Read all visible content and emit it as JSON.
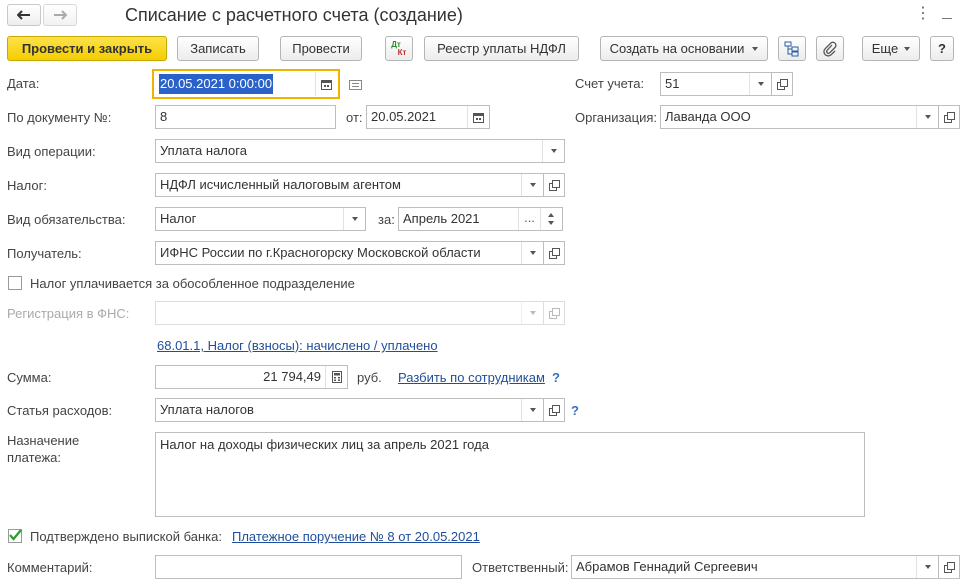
{
  "window": {
    "title": "Списание с расчетного счета (создание)"
  },
  "toolbar": {
    "post_close": "Провести и закрыть",
    "write": "Записать",
    "post": "Провести",
    "dtkt_top": "Дт",
    "dtkt_bottom": "Кт",
    "registry": "Реестр уплаты НДФЛ",
    "create_based": "Создать на основании",
    "more": "Еще",
    "help": "?"
  },
  "form": {
    "date_label": "Дата:",
    "date_value": "20.05.2021  0:00:00",
    "account_label": "Счет учета:",
    "account_value": "51",
    "docnum_label": "По документу №:",
    "docnum_value": "8",
    "from_label": "от:",
    "from_value": "20.05.2021",
    "org_label": "Организация:",
    "org_value": "Лаванда ООО",
    "optype_label": "Вид операции:",
    "optype_value": "Уплата налога",
    "tax_label": "Налог:",
    "tax_value": "НДФЛ исчисленный налоговым агентом",
    "liability_label": "Вид обязательства:",
    "liability_value": "Налог",
    "period_label": "за:",
    "period_value": "Апрель 2021",
    "period_btn": "...",
    "recipient_label": "Получатель:",
    "recipient_value": "ИФНС России по г.Красногорску Московской области",
    "separate_label": "Налог уплачивается за обособленное подразделение",
    "separate_checked": false,
    "fns_label": "Регистрация в ФНС:",
    "fns_value": "",
    "account_link": "68.01.1, Налог (взносы): начислено / уплачено",
    "sum_label": "Сумма:",
    "sum_value": "21 794,49",
    "currency": "руб.",
    "split_link": "Разбить по сотрудникам",
    "split_help": "?",
    "expense_label": "Статья расходов:",
    "expense_value": "Уплата налогов",
    "expense_help": "?",
    "purpose_label_1": "Назначение",
    "purpose_label_2": "платежа:",
    "purpose_value": "Налог на доходы физических лиц за апрель 2021 года",
    "confirmed_label": "Подтверждено выпиской банка:",
    "confirmed_checked": true,
    "payment_link": "Платежное поручение № 8 от 20.05.2021",
    "comment_label": "Комментарий:",
    "comment_value": "",
    "responsible_label": "Ответственный:",
    "responsible_value": "Абрамов Геннадий Сергеевич"
  },
  "colors": {
    "primary_button": "#f4cd00",
    "link": "#1f4f9c",
    "focus_border": "#f0b400",
    "selection": "#2a62c9"
  }
}
